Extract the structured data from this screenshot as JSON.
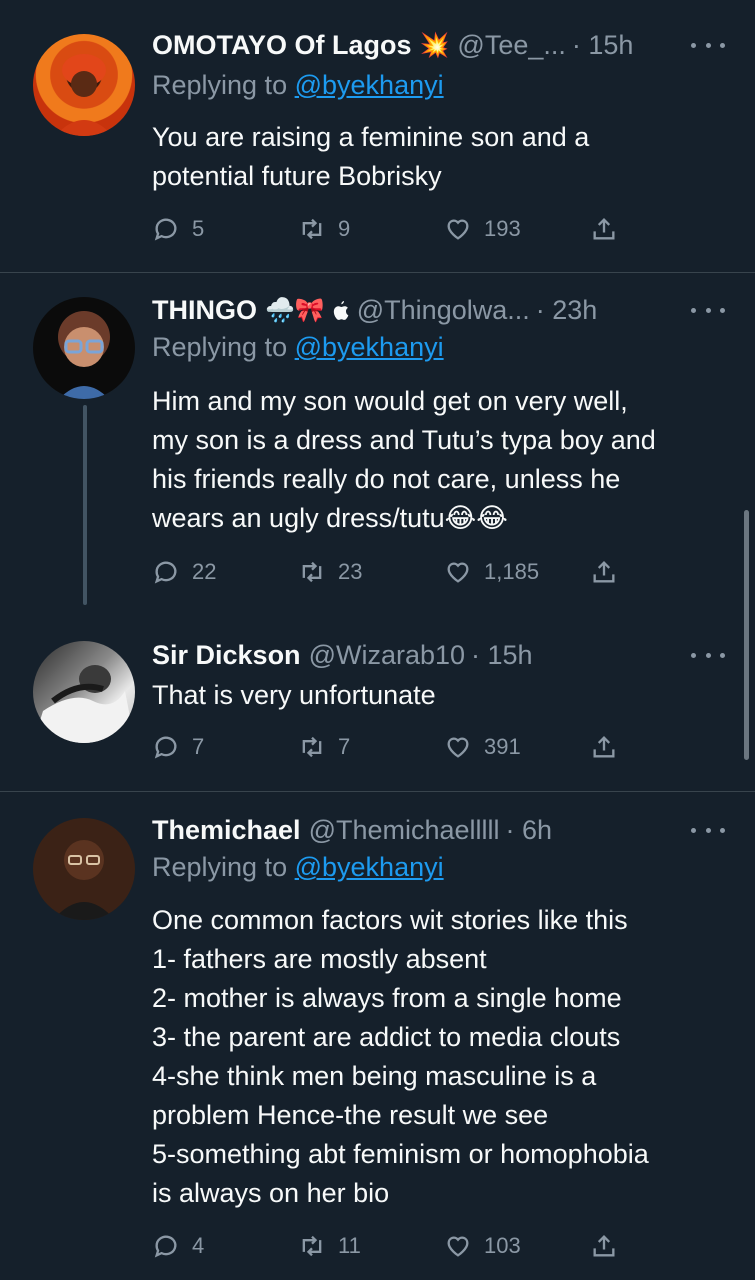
{
  "tweets": [
    {
      "name": "OMOTAYO Of Lagos",
      "badges": "💥",
      "handle": "@Tee_...",
      "time": "· 15h",
      "replying_prefix": "Replying to",
      "replying_to": "@byekhanyi",
      "lines": [
        "You are raising a feminine son and a",
        "potential future Bobrisky"
      ],
      "replies": "5",
      "retweets": "9",
      "likes": "193"
    },
    {
      "name": "THINGO",
      "badges": "🌧️🎀",
      "handle": "@Thingolwa...",
      "time": "· 23h",
      "replying_prefix": "Replying to",
      "replying_to": "@byekhanyi",
      "lines": [
        "Him and my son would get on very well,",
        "my son is a dress and Tutu’s typa boy and",
        "his friends really do not care, unless he",
        "wears an ugly dress/tutu😂😂"
      ],
      "replies": "22",
      "retweets": "23",
      "likes": "1,185"
    },
    {
      "name": "Sir Dickson",
      "handle": "@Wizarab10",
      "time": "· 15h",
      "lines": [
        "That is very unfortunate"
      ],
      "replies": "7",
      "retweets": "7",
      "likes": "391"
    },
    {
      "name": "Themichael",
      "handle": "@Themichaelllll",
      "time": "· 6h",
      "replying_prefix": "Replying to",
      "replying_to": "@byekhanyi",
      "lines": [
        "One common factors wit stories like this",
        "1- fathers are mostly absent",
        "2- mother is always from a single home",
        "3- the parent are addict to media clouts",
        "4-she think men being masculine is a",
        "problem Hence-the result we see",
        "5-something abt feminism or homophobia",
        "is always on her bio"
      ],
      "replies": "4",
      "retweets": "11",
      "likes": "103"
    }
  ],
  "colors": {
    "background": "#15202b",
    "text": "#f7f9f9",
    "secondary": "#8b98a5",
    "link": "#1d9bf0",
    "divider": "#38444d"
  },
  "icons": [
    "reply-icon",
    "retweet-icon",
    "like-icon",
    "share-icon",
    "more-icon",
    "apple-icon"
  ]
}
